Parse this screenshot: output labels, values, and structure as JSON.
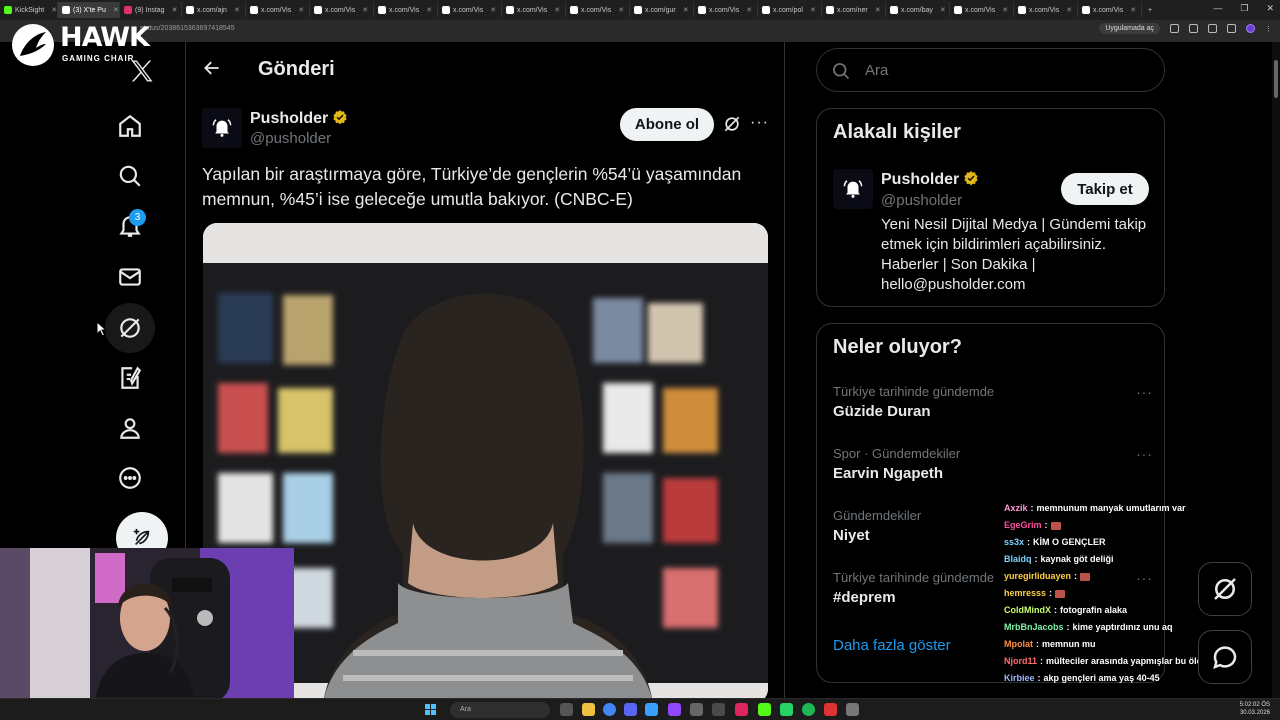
{
  "browser": {
    "tabs": [
      {
        "label": "KickSight",
        "color": "#53fc18"
      },
      {
        "label": "(3) X'te Pu",
        "color": "#ffffff",
        "active": true
      },
      {
        "label": "(9) Instag",
        "color": "#e1306c"
      },
      {
        "label": "x.com/ajn",
        "color": "#ffffff"
      },
      {
        "label": "x.com/Vis",
        "color": "#ffffff"
      },
      {
        "label": "x.com/Vis",
        "color": "#ffffff"
      },
      {
        "label": "x.com/Vis",
        "color": "#ffffff"
      },
      {
        "label": "x.com/Vis",
        "color": "#ffffff"
      },
      {
        "label": "x.com/Vis",
        "color": "#ffffff"
      },
      {
        "label": "x.com/Vis",
        "color": "#ffffff"
      },
      {
        "label": "x.com/gur",
        "color": "#ffffff"
      },
      {
        "label": "x.com/Vis",
        "color": "#ffffff"
      },
      {
        "label": "x.com/pol",
        "color": "#ffffff"
      },
      {
        "label": "x.com/ner",
        "color": "#ffffff"
      },
      {
        "label": "x.com/bay",
        "color": "#ffffff"
      },
      {
        "label": "x.com/Vis",
        "color": "#ffffff"
      },
      {
        "label": "x.com/Vis",
        "color": "#ffffff"
      },
      {
        "label": "x.com/Vis",
        "color": "#ffffff"
      }
    ],
    "url": "status/2038615363697418545",
    "open_in_app": "Uygulamada aç"
  },
  "logo": {
    "text": "HAWK",
    "sub": "GAMING CHAIR"
  },
  "nav": {
    "notification_count": "3"
  },
  "header": {
    "title": "Gönderi"
  },
  "post": {
    "author_name": "Pusholder",
    "author_handle": "@pusholder",
    "follow_label": "Abone ol",
    "more_label": "···",
    "text": "Yapılan bir araştırmaya göre, Türkiye’de gençlerin %54’ü yaşamından memnun, %45’i ise geleceğe umutla bakıyor. (CNBC-E)"
  },
  "search": {
    "placeholder": "Ara"
  },
  "related": {
    "title": "Alakalı kişiler",
    "name": "Pusholder",
    "handle": "@pusholder",
    "follow_label": "Takip et",
    "bio": "Yeni Nesil Dijital Medya | Gündemi takip etmek için bildirimleri açabilirsiniz. Haberler | Son Dakika | hello@pusholder.com"
  },
  "trends": {
    "title": "Neler oluyor?",
    "items": [
      {
        "context": "Türkiye tarihinde gündemde",
        "name": "Güzide Duran"
      },
      {
        "context": "Spor · Gündemdekiler",
        "name": "Earvin Ngapeth"
      },
      {
        "context": "Gündemdekiler",
        "name": "Niyet"
      },
      {
        "context": "Türkiye tarihinde gündemde",
        "name": "#deprem"
      }
    ],
    "more_icon": "···",
    "show_more": "Daha fazla göster"
  },
  "chat": [
    {
      "user": "Axzik",
      "color": "#ff9bd5",
      "msg": "memnunum manyak umutlarım var"
    },
    {
      "user": "EgeGrim",
      "color": "#ff4fa0",
      "msg": "",
      "emote": true
    },
    {
      "user": "ss3x",
      "color": "#7fd3ff",
      "msg": "KİM O GENÇLER"
    },
    {
      "user": "Blaidq",
      "color": "#7fd3ff",
      "msg": "kaynak göt deliği"
    },
    {
      "user": "yuregirliduayen",
      "color": "#ffd23f",
      "msg": "",
      "emote": true
    },
    {
      "user": "hemresss",
      "color": "#ffd23f",
      "msg": "",
      "emote": true
    },
    {
      "user": "ColdMindX",
      "color": "#c6ff6b",
      "msg": "fotografin alaka"
    },
    {
      "user": "MrbBnJacobs",
      "color": "#7ef2a8",
      "msg": "kime yaptırdınız unu aq"
    },
    {
      "user": "Mpolat",
      "color": "#ff8c42",
      "msg": "memnun mu"
    },
    {
      "user": "Njord11",
      "color": "#ff6b6b",
      "msg": "mülteciler arasında yapmışlar bu ölçümü"
    },
    {
      "user": "Kirbiee",
      "color": "#9fb7ff",
      "msg": "akp gençleri ama yaş 40-45"
    }
  ],
  "taskbar": {
    "search": "Ara",
    "time": "5:02:02 ÖS",
    "date": "30.03.2026"
  }
}
